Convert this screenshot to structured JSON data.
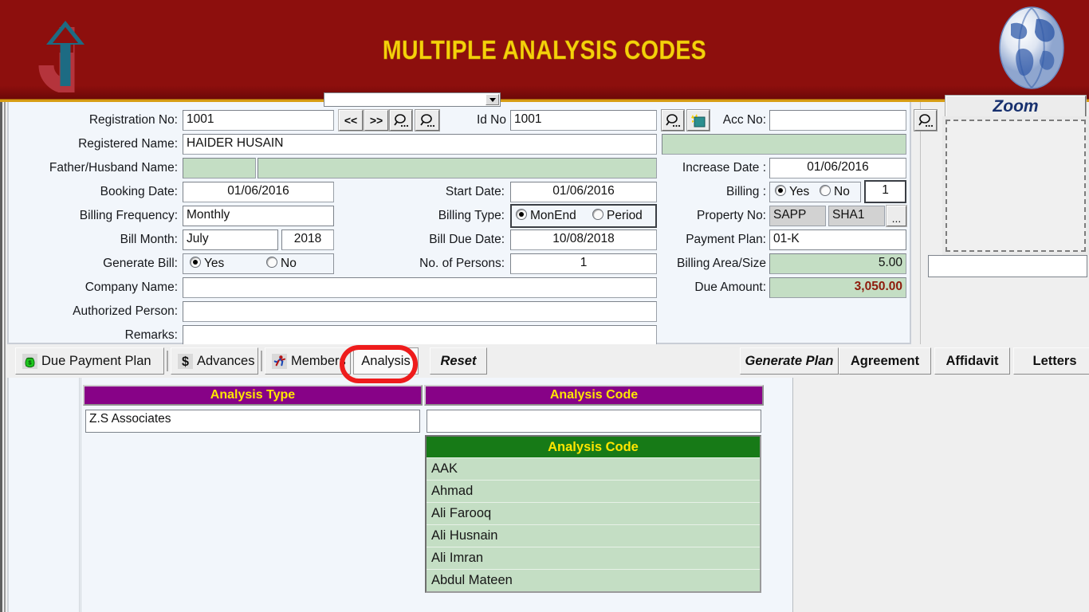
{
  "banner": {
    "title": "MULTIPLE ANALYSIS CODES",
    "bg_color": "#8d0f0d",
    "title_color": "#f5d10a",
    "accent_color": "#d9a017"
  },
  "form": {
    "registration_no": {
      "label": "Registration No:",
      "value": "1001"
    },
    "registered_name": {
      "label": "Registered Name:",
      "value": "HAIDER HUSAIN"
    },
    "father_husband_name": {
      "label": "Father/Husband Name:",
      "value": ""
    },
    "booking_date": {
      "label": "Booking Date:",
      "value": "01/06/2016"
    },
    "billing_frequency": {
      "label": "Billing Frequency:",
      "value": "Monthly"
    },
    "bill_month": {
      "label": "Bill Month:",
      "value": "July",
      "year": "2018"
    },
    "generate_bill": {
      "label": "Generate Bill:",
      "yes": "Yes",
      "no": "No",
      "selected": "Yes"
    },
    "company_name": {
      "label": "Company Name:",
      "value": ""
    },
    "authorized_person": {
      "label": "Authorized Person:",
      "value": ""
    },
    "remarks": {
      "label": "Remarks:",
      "value": ""
    },
    "id_no": {
      "label": "Id No",
      "value": "1001"
    },
    "start_date": {
      "label": "Start Date:",
      "value": "01/06/2016"
    },
    "billing_type": {
      "label": "Billing Type:",
      "monend": "MonEnd",
      "period": "Period",
      "selected": "MonEnd"
    },
    "bill_due_date": {
      "label": "Bill Due Date:",
      "value": "10/08/2018"
    },
    "no_of_persons": {
      "label": "No. of Persons:",
      "value": "1"
    },
    "acc_no": {
      "label": "Acc No:",
      "value": ""
    },
    "increase_date": {
      "label": "Increase Date :",
      "value": "01/06/2016"
    },
    "billing": {
      "label": "Billing :",
      "yes": "Yes",
      "no": "No",
      "selected": "Yes",
      "count": "1"
    },
    "property_no": {
      "label": "Property No:",
      "value1": "SAPP",
      "value2": "SHA1",
      "more": "..."
    },
    "payment_plan": {
      "label": "Payment Plan:",
      "value": "01-K"
    },
    "billing_area_size": {
      "label": "Billing Area/Size",
      "value": "5.00"
    },
    "due_amount": {
      "label": "Due Amount:",
      "value": "3,050.00",
      "color": "#8e1b0c"
    },
    "nav": {
      "prev": "<<",
      "next": ">>"
    },
    "zoom_panel": {
      "button_label": "Zoom",
      "dropdown_value": ""
    }
  },
  "tabs": [
    {
      "label": "Due Payment Plan",
      "icon": "money-bag-icon",
      "selected": false
    },
    {
      "label": "Advances",
      "icon": "dollar-icon",
      "selected": false
    },
    {
      "label": "Members",
      "icon": "runner-icon",
      "selected": false
    },
    {
      "label": "Analysis",
      "icon": "",
      "selected": true
    },
    {
      "label": "Reset",
      "icon": "",
      "selected": false
    }
  ],
  "action_buttons": [
    {
      "label": "Generate Plan",
      "style": "bold-italic"
    },
    {
      "label": "Agreement",
      "style": "bold"
    },
    {
      "label": "Affidavit",
      "style": "bold"
    },
    {
      "label": "Letters",
      "style": "bold"
    }
  ],
  "grid": {
    "header_bg": "#870287",
    "header_fg": "#ffe600",
    "columns": [
      {
        "label": "Analysis Type",
        "value": "Z.S Associates"
      },
      {
        "label": "Analysis Code",
        "value": ""
      }
    ]
  },
  "dropdown": {
    "header": "Analysis Code",
    "header_bg": "#177a17",
    "header_fg": "#ffe600",
    "row_bg": "#c4dec4",
    "options": [
      "AAK",
      "Ahmad",
      "Ali Farooq",
      "Ali Husnain",
      "Ali Imran",
      "Abdul Mateen"
    ]
  },
  "annotation": {
    "shape": "red-oval-highlight",
    "target": "Analysis",
    "color": "#ee1c1c"
  }
}
